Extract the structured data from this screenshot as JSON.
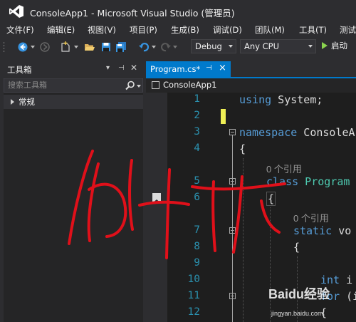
{
  "window": {
    "title": "ConsoleApp1 - Microsoft Visual Studio (管理员)"
  },
  "menu": [
    {
      "id": "file",
      "label": "文件(F)"
    },
    {
      "id": "edit",
      "label": "编辑(E)"
    },
    {
      "id": "view",
      "label": "视图(V)"
    },
    {
      "id": "project",
      "label": "项目(P)"
    },
    {
      "id": "build",
      "label": "生成(B)"
    },
    {
      "id": "debug",
      "label": "调试(D)"
    },
    {
      "id": "team",
      "label": "团队(M)"
    },
    {
      "id": "tools",
      "label": "工具(T)"
    },
    {
      "id": "test",
      "label": "测试"
    }
  ],
  "toolbar": {
    "configuration": "Debug",
    "platform": "Any CPU",
    "start_label": "启动"
  },
  "toolbox": {
    "title": "工具箱",
    "search_placeholder": "搜索工具箱",
    "group_label": "常规"
  },
  "editor": {
    "tab_label": "Program.cs*",
    "nav_project": "ConsoleApp1",
    "line_numbers": [
      "1",
      "2",
      "3",
      "4",
      "5",
      "6",
      "7",
      "8",
      "9",
      "10",
      "11",
      "12"
    ],
    "lines": {
      "l1_kw": "using",
      "l1_rest": " System;",
      "l3_kw": "namespace",
      "l3_rest": " ConsoleA",
      "l4": "{",
      "lens1": "0 个引用",
      "l5_kw": "class",
      "l5_rest": " Program",
      "l6": "{",
      "lens2": "0 个引用",
      "l7_kw": "static",
      "l7_rest": " vo",
      "l8": "{",
      "l10_kw": "int",
      "l10_rest": " i",
      "l11_kw": "for",
      "l11_rest": " (i",
      "l12": "{"
    },
    "colors": {
      "keyword": "#569cd6",
      "text": "#dcdcdc",
      "line_number": "#2b91af",
      "active_tab": "#007acc"
    }
  },
  "annotation": {
    "description_icon": "red-handwriting-overlay"
  },
  "watermark": {
    "logo": "Baidu经验",
    "url": "jingyan.baidu.com"
  }
}
